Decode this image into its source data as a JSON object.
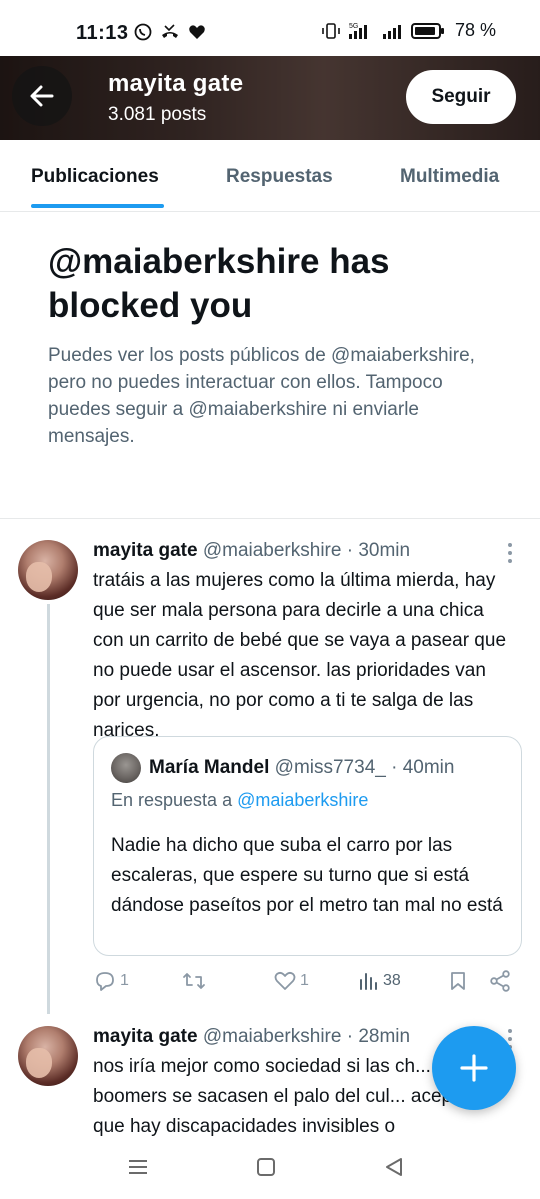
{
  "status_bar": {
    "time": "11:13",
    "battery": "78 %",
    "network": "5G"
  },
  "header": {
    "name": "mayita gate",
    "posts_count": "3.081 posts",
    "follow_label": "Seguir"
  },
  "tabs": [
    {
      "label": "Publicaciones",
      "active": true
    },
    {
      "label": "Respuestas",
      "active": false
    },
    {
      "label": "Multimedia",
      "active": false
    }
  ],
  "block_notice": {
    "title": "@maiaberkshire has blocked you",
    "description": "Puedes ver los posts públicos de @maiaberkshire, pero no puedes interactuar con ellos. Tampoco puedes seguir a @maiaberkshire ni enviarle mensajes."
  },
  "posts": [
    {
      "name": "mayita gate",
      "handle": "@maiaberkshire",
      "time": "· 30min",
      "text": "tratáis a las mujeres como la última mierda, hay que ser mala persona para decirle a una chica con un carrito de bebé que se vaya a pasear que no puede usar el ascensor. las prioridades van por urgencia, no por como a ti te salga de las narices.",
      "quote": {
        "name": "María Mandel",
        "handle": "@miss7734_",
        "time": "· 40min",
        "reply_prefix": "En respuesta a",
        "reply_to": "@maiaberkshire",
        "text": "Nadie ha dicho que suba el carro por las escaleras, que espere su turno que si está dándose paseítos por el metro tan mal no está"
      },
      "actions": {
        "replies": "1",
        "reposts": "",
        "likes": "1",
        "views": "38"
      }
    },
    {
      "name": "mayita gate",
      "handle": "@maiaberkshire",
      "time": "· 28min",
      "text": "nos iría mejor como sociedad si las ch... los boomers se sacasen el palo del cul... aceptasen que hay discapacidades invisibles o"
    }
  ],
  "colors": {
    "accent": "#1d9bf0",
    "text_primary": "#0f1419",
    "text_secondary": "#536471"
  }
}
